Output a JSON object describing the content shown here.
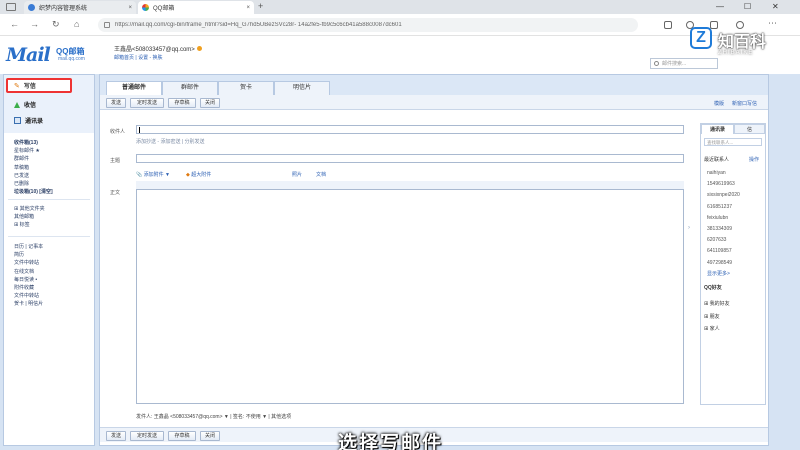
{
  "browser": {
    "tabs": [
      {
        "label": "织梦内容管理系统",
        "close": "×"
      },
      {
        "label": "QQ邮箱",
        "close": "×"
      }
    ],
    "new_tab": "+",
    "window_controls": [
      "—",
      "☐",
      "✕"
    ],
    "url": "https://mail.qq.com/cgi-bin/frame_html?sid=Hq_G7hd5UBezSVc28r- 14a2fe5-fb9c5c6cb41a588c0087dc601"
  },
  "mail_header": {
    "logo": "Mail",
    "logo_brand": "QQ邮箱",
    "logo_domain": "mail.qq.com",
    "user": "王鑫晶<508033457@qq.com>",
    "links": "邮箱首页 | 设置 - 换肤",
    "search_placeholder": "邮件搜索..."
  },
  "watermark": {
    "mark": "Z",
    "name": "知百科",
    "sub": "ZHIBAIKE"
  },
  "sidebar": {
    "compose": "写信",
    "inbox": "收信",
    "contacts": "通讯录",
    "folders": [
      {
        "label": "收件箱(13)"
      },
      {
        "label": "星标邮件 ★"
      },
      {
        "label": "群邮件"
      },
      {
        "label": "草稿箱"
      },
      {
        "label": "已发送"
      },
      {
        "label": "已删除"
      },
      {
        "label": "垃圾箱(10) [清空]"
      }
    ],
    "sections": [
      {
        "label": "⊞ 其他文件夹"
      },
      {
        "label": "其他邮箱"
      },
      {
        "label": "⊞ 标签"
      }
    ],
    "apps": [
      {
        "label": "日历 | 记事本"
      },
      {
        "label": "简历"
      },
      {
        "label": "文件中转站"
      },
      {
        "label": "在线文档"
      },
      {
        "label": "每日悦读 •"
      },
      {
        "label": "附件收藏"
      },
      {
        "label": "文件中转站"
      },
      {
        "label": "贺卡 | 明信片"
      }
    ]
  },
  "compose_tabs": [
    "普通邮件",
    "群邮件",
    "贺卡",
    "明信片"
  ],
  "toolbar": {
    "send": "发送",
    "timed_send": "定时发送",
    "save_draft": "存草稿",
    "close": "关闭",
    "right_1": "模版",
    "right_2": "新窗口写信"
  },
  "form": {
    "to_label": "收件人",
    "to_links": "添加抄送 - 添加密送 | 分别发送",
    "subject_label": "主题",
    "attach": "添加附件",
    "super_attach": "超大附件",
    "photo": "照片",
    "doc": "文档",
    "body_label": "正文"
  },
  "sender_line": "发件人: 王鑫晶 <508033457@qq.com> ▼ | 签名: 不使用 ▼ | 其他选项",
  "bottom_toolbar": {
    "send": "发送",
    "timed_send": "定时发送",
    "save_draft": "存草稿",
    "close": "关闭"
  },
  "contacts_panel": {
    "tab_contacts": "通讯录",
    "tab_other": "信",
    "search_placeholder": "查找联系人...",
    "recent_label": "最近联系人",
    "recent_action": "操作",
    "recent": [
      "naihiyan",
      "1549619963",
      "sixsixnpei2020",
      "616851237",
      "feixiulubn",
      "381334309",
      "6207633",
      "641109857",
      "497298549",
      "显示更多>"
    ],
    "qq_label": "QQ好友",
    "groups": [
      "⊞ 我的好友",
      "⊞ 朋友",
      "⊞ 家人"
    ]
  },
  "caption": "选择写邮件"
}
